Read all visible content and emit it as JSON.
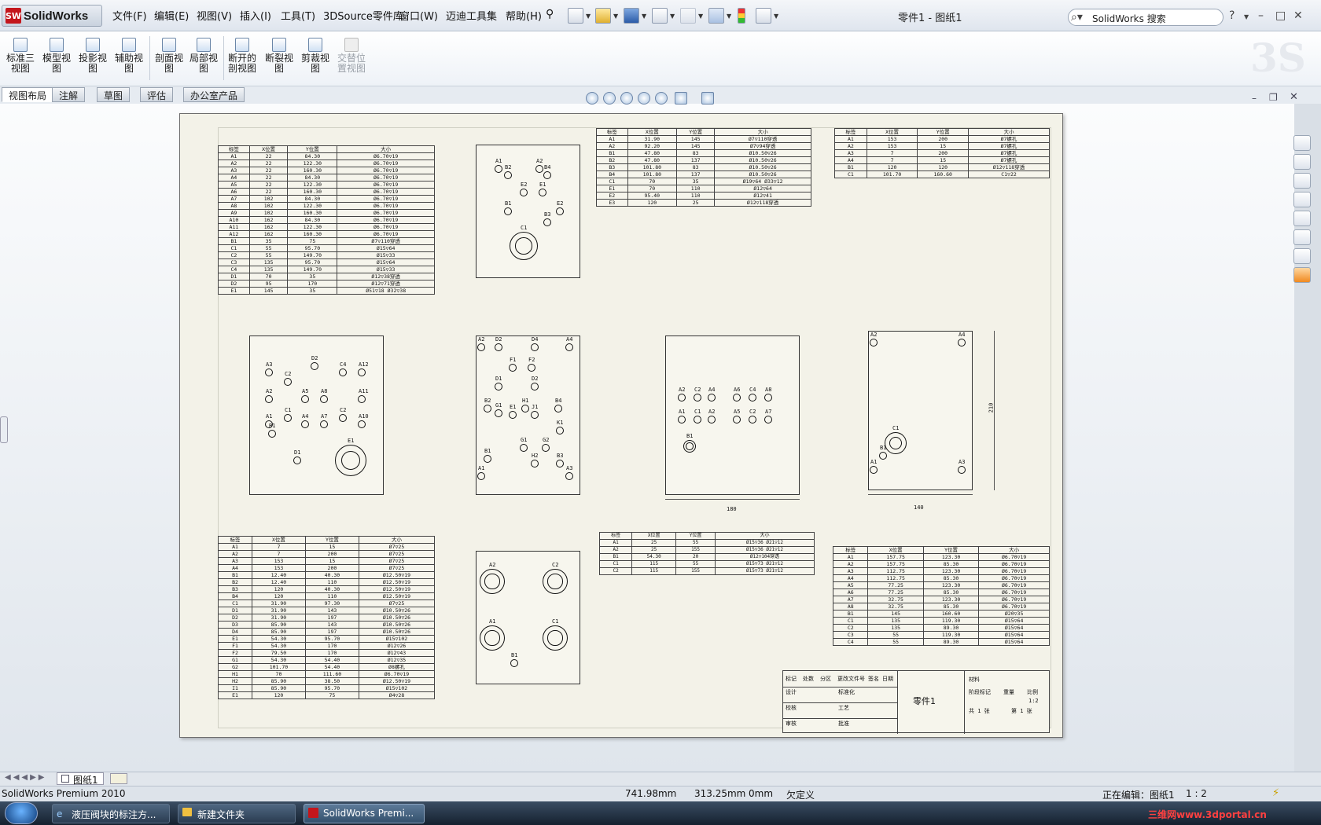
{
  "app": {
    "logo_mark": "SW",
    "logo_text": "SolidWorks",
    "doc_title": "零件1 - 图纸1",
    "search_placeholder": "SolidWorks 搜索"
  },
  "menu": [
    "文件(F)",
    "编辑(E)",
    "视图(V)",
    "插入(I)",
    "工具(T)",
    "3DSource零件库",
    "窗口(W)",
    "迈迪工具集",
    "帮助(H)"
  ],
  "commands": [
    {
      "label": "标准三视图",
      "icon": "standard-3view-icon"
    },
    {
      "label": "模型视图",
      "icon": "model-view-icon"
    },
    {
      "label": "投影视图",
      "icon": "projected-view-icon"
    },
    {
      "label": "辅助视图",
      "icon": "auxiliary-view-icon"
    },
    {
      "label": "剖面视图",
      "icon": "section-view-icon"
    },
    {
      "label": "局部视图",
      "icon": "detail-view-icon"
    },
    {
      "label": "断开的剖视图",
      "icon": "broken-out-section-icon"
    },
    {
      "label": "断裂视图",
      "icon": "break-view-icon"
    },
    {
      "label": "剪裁视图",
      "icon": "crop-view-icon"
    },
    {
      "label": "交替位置视图",
      "icon": "alternate-position-icon",
      "disabled": true
    }
  ],
  "tabs": [
    "视图布局",
    "注解",
    "草图",
    "评估",
    "办公室产品"
  ],
  "sheet": {
    "table1": {
      "headers": [
        "标签",
        "X位置",
        "Y位置",
        "大小"
      ],
      "rows": [
        [
          "A1",
          "22",
          "84.30",
          "Ø6.70▽19"
        ],
        [
          "A2",
          "22",
          "122.30",
          "Ø6.70▽19"
        ],
        [
          "A3",
          "22",
          "160.30",
          "Ø6.70▽19"
        ],
        [
          "A4",
          "22",
          "84.30",
          "Ø6.70▽19"
        ],
        [
          "A5",
          "22",
          "122.30",
          "Ø6.70▽19"
        ],
        [
          "A6",
          "22",
          "160.30",
          "Ø6.70▽19"
        ],
        [
          "A7",
          "102",
          "84.30",
          "Ø6.70▽19"
        ],
        [
          "A8",
          "102",
          "122.30",
          "Ø6.70▽19"
        ],
        [
          "A9",
          "102",
          "160.30",
          "Ø6.70▽19"
        ],
        [
          "A10",
          "162",
          "84.30",
          "Ø6.70▽19"
        ],
        [
          "A11",
          "162",
          "122.30",
          "Ø6.70▽19"
        ],
        [
          "A12",
          "162",
          "160.30",
          "Ø6.70▽19"
        ],
        [
          "B1",
          "35",
          "75",
          "Ø7▽110穿透"
        ],
        [
          "C1",
          "55",
          "95.70",
          "Ø15▽64"
        ],
        [
          "C2",
          "55",
          "149.70",
          "Ø15▽33"
        ],
        [
          "C3",
          "135",
          "95.70",
          "Ø15▽64"
        ],
        [
          "C4",
          "135",
          "149.70",
          "Ø15▽33"
        ],
        [
          "D1",
          "70",
          "35",
          "Ø12▽38穿透"
        ],
        [
          "D2",
          "95",
          "170",
          "Ø12▽71穿透"
        ],
        [
          "E1",
          "145",
          "35",
          "Ø51▽18 Ø32▽38"
        ]
      ]
    },
    "table2": {
      "headers": [
        "标签",
        "X位置",
        "Y位置",
        "大小"
      ],
      "rows": [
        [
          "A1",
          "31.90",
          "145",
          "Ø7▽110穿透"
        ],
        [
          "A2",
          "92.20",
          "145",
          "Ø7▽94穿透"
        ],
        [
          "B1",
          "47.80",
          "83",
          "Ø10.50▽26"
        ],
        [
          "B2",
          "47.80",
          "137",
          "Ø10.50▽26"
        ],
        [
          "B3",
          "101.80",
          "83",
          "Ø10.50▽26"
        ],
        [
          "B4",
          "101.80",
          "137",
          "Ø10.50▽26"
        ],
        [
          "C1",
          "70",
          "35",
          "Ø19▽64 Ø33▽12"
        ],
        [
          "E1",
          "70",
          "110",
          "Ø12▽64"
        ],
        [
          "E2",
          "95.40",
          "110",
          "Ø12▽41"
        ],
        [
          "E3",
          "120",
          "25",
          "Ø12▽118穿透"
        ]
      ]
    },
    "table3": {
      "headers": [
        "标签",
        "X位置",
        "Y位置",
        "大小"
      ],
      "rows": [
        [
          "A1",
          "153",
          "200",
          "Ø7螺孔"
        ],
        [
          "A2",
          "153",
          "15",
          "Ø7螺孔"
        ],
        [
          "A3",
          "7",
          "200",
          "Ø7螺孔"
        ],
        [
          "A4",
          "7",
          "15",
          "Ø7螺孔"
        ],
        [
          "B1",
          "120",
          "120",
          "Ø12▽118穿透"
        ],
        [
          "C1",
          "101.70",
          "160.60",
          "C1▽22"
        ]
      ]
    },
    "table4": {
      "headers": [
        "标签",
        "X位置",
        "Y位置",
        "大小"
      ],
      "rows": [
        [
          "A1",
          "7",
          "15",
          "Ø7▽25"
        ],
        [
          "A2",
          "7",
          "200",
          "Ø7▽25"
        ],
        [
          "A3",
          "153",
          "15",
          "Ø7▽25"
        ],
        [
          "A4",
          "153",
          "200",
          "Ø7▽25"
        ],
        [
          "B1",
          "12.40",
          "40.30",
          "Ø12.50▽19"
        ],
        [
          "B2",
          "12.40",
          "110",
          "Ø12.50▽19"
        ],
        [
          "B3",
          "120",
          "40.30",
          "Ø12.50▽19"
        ],
        [
          "B4",
          "120",
          "110",
          "Ø12.50▽19"
        ],
        [
          "C1",
          "31.90",
          "97.30",
          "Ø7▽25"
        ],
        [
          "D1",
          "31.90",
          "143",
          "Ø10.50▽26"
        ],
        [
          "D2",
          "31.90",
          "197",
          "Ø10.50▽26"
        ],
        [
          "D3",
          "85.90",
          "143",
          "Ø10.50▽26"
        ],
        [
          "D4",
          "85.90",
          "197",
          "Ø10.50▽26"
        ],
        [
          "E1",
          "54.30",
          "95.70",
          "Ø15▽102"
        ],
        [
          "F1",
          "54.30",
          "170",
          "Ø12▽26"
        ],
        [
          "F2",
          "79.50",
          "170",
          "Ø12▽43"
        ],
        [
          "G1",
          "54.30",
          "54.40",
          "Ø12▽35"
        ],
        [
          "G2",
          "101.70",
          "54.40",
          "Ø8螺孔"
        ],
        [
          "H1",
          "70",
          "111.60",
          "Ø6.70▽19"
        ],
        [
          "H2",
          "85.90",
          "38.50",
          "Ø12.50▽19"
        ],
        [
          "I1",
          "85.90",
          "95.70",
          "Ø15▽102"
        ],
        [
          "E1",
          "120",
          "75",
          "Ø4▽28"
        ]
      ]
    },
    "table5": {
      "headers": [
        "标签",
        "X位置",
        "Y位置",
        "大小"
      ],
      "rows": [
        [
          "A1",
          "25",
          "55",
          "Ø15▽36 Ø21▽12"
        ],
        [
          "A2",
          "25",
          "155",
          "Ø15▽36 Ø21▽12"
        ],
        [
          "B1",
          "54.30",
          "20",
          "Ø12▽104穿透"
        ],
        [
          "C1",
          "115",
          "55",
          "Ø15▽73 Ø21▽12"
        ],
        [
          "C2",
          "115",
          "155",
          "Ø15▽73 Ø21▽12"
        ]
      ]
    },
    "table6": {
      "headers": [
        "标签",
        "X位置",
        "Y位置",
        "大小"
      ],
      "rows": [
        [
          "A1",
          "157.75",
          "123.30",
          "Ø6.70▽19"
        ],
        [
          "A2",
          "157.75",
          "85.30",
          "Ø6.70▽19"
        ],
        [
          "A3",
          "112.75",
          "123.30",
          "Ø6.70▽19"
        ],
        [
          "A4",
          "112.75",
          "85.30",
          "Ø6.70▽19"
        ],
        [
          "A5",
          "77.25",
          "123.30",
          "Ø6.70▽19"
        ],
        [
          "A6",
          "77.25",
          "85.30",
          "Ø6.70▽19"
        ],
        [
          "A7",
          "32.75",
          "123.30",
          "Ø6.70▽19"
        ],
        [
          "A8",
          "32.75",
          "85.30",
          "Ø6.70▽19"
        ],
        [
          "B1",
          "145",
          "160.60",
          "Ø20▽35"
        ],
        [
          "C1",
          "135",
          "119.30",
          "Ø15▽64"
        ],
        [
          "C2",
          "135",
          "89.30",
          "Ø15▽64"
        ],
        [
          "C3",
          "55",
          "119.30",
          "Ø15▽64"
        ],
        [
          "C4",
          "55",
          "89.30",
          "Ø15▽64"
        ]
      ]
    },
    "views": {
      "v1": [
        "A1",
        "A2",
        "B4",
        "B2",
        "E2",
        "E1",
        "E2",
        "B1",
        "B3",
        "C1"
      ],
      "v3": [
        "A3",
        "C2",
        "D2",
        "C4",
        "A12",
        "A2",
        "A5",
        "A8",
        "A11",
        "A1",
        "C1",
        "A4",
        "C2",
        "A10",
        "B1",
        "A7",
        "D1",
        "E1"
      ],
      "v4": [
        "D2",
        "D4",
        "A2",
        "A4",
        "F1",
        "F2",
        "D1",
        "D2",
        "B2",
        "G1",
        "E1",
        "H1",
        "J1",
        "B4",
        "G1",
        "G2",
        "K1",
        "B1",
        "H2",
        "B3",
        "A1",
        "A3"
      ],
      "v5": [
        "C2",
        "C4",
        "A2",
        "A4",
        "A6",
        "A8",
        "C1",
        "C2",
        "A1",
        "A2",
        "A5",
        "A7",
        "B1"
      ],
      "v6": [
        "A2",
        "A4",
        "C1",
        "A1",
        "B1",
        "A3"
      ],
      "v7": [
        "A2",
        "C2",
        "A1",
        "C1",
        "B1"
      ]
    },
    "dims": {
      "w180": "180",
      "w140": "140",
      "h210": "210"
    },
    "titleblock": {
      "part": "零件1",
      "rows": [
        "标记",
        "处数",
        "分区",
        "更改文件号",
        "签名",
        "日期"
      ],
      "labels": [
        "设计",
        "标准化",
        "校核",
        "审核",
        "工艺",
        "批准"
      ],
      "stage": "阶段标记",
      "weight": "重量",
      "scale": "比例",
      "scale_val": "1:2",
      "sheet": "共 1 张",
      "sheet2": "第 1 张",
      "material": "材料",
      "part_no": "零件1"
    }
  },
  "sheettab": "图纸1",
  "status": {
    "product": "SolidWorks Premium 2010",
    "x": "741.98mm",
    "y": "313.25mm",
    "z": "0mm",
    "state": "欠定义",
    "editing": "正在编辑：图纸1",
    "scale": "1 : 2"
  },
  "taskbar": [
    "液压阀块的标注方...",
    "新建文件夹",
    "SolidWorks Premi..."
  ],
  "watermark": "三维网www.3dportal.cn"
}
